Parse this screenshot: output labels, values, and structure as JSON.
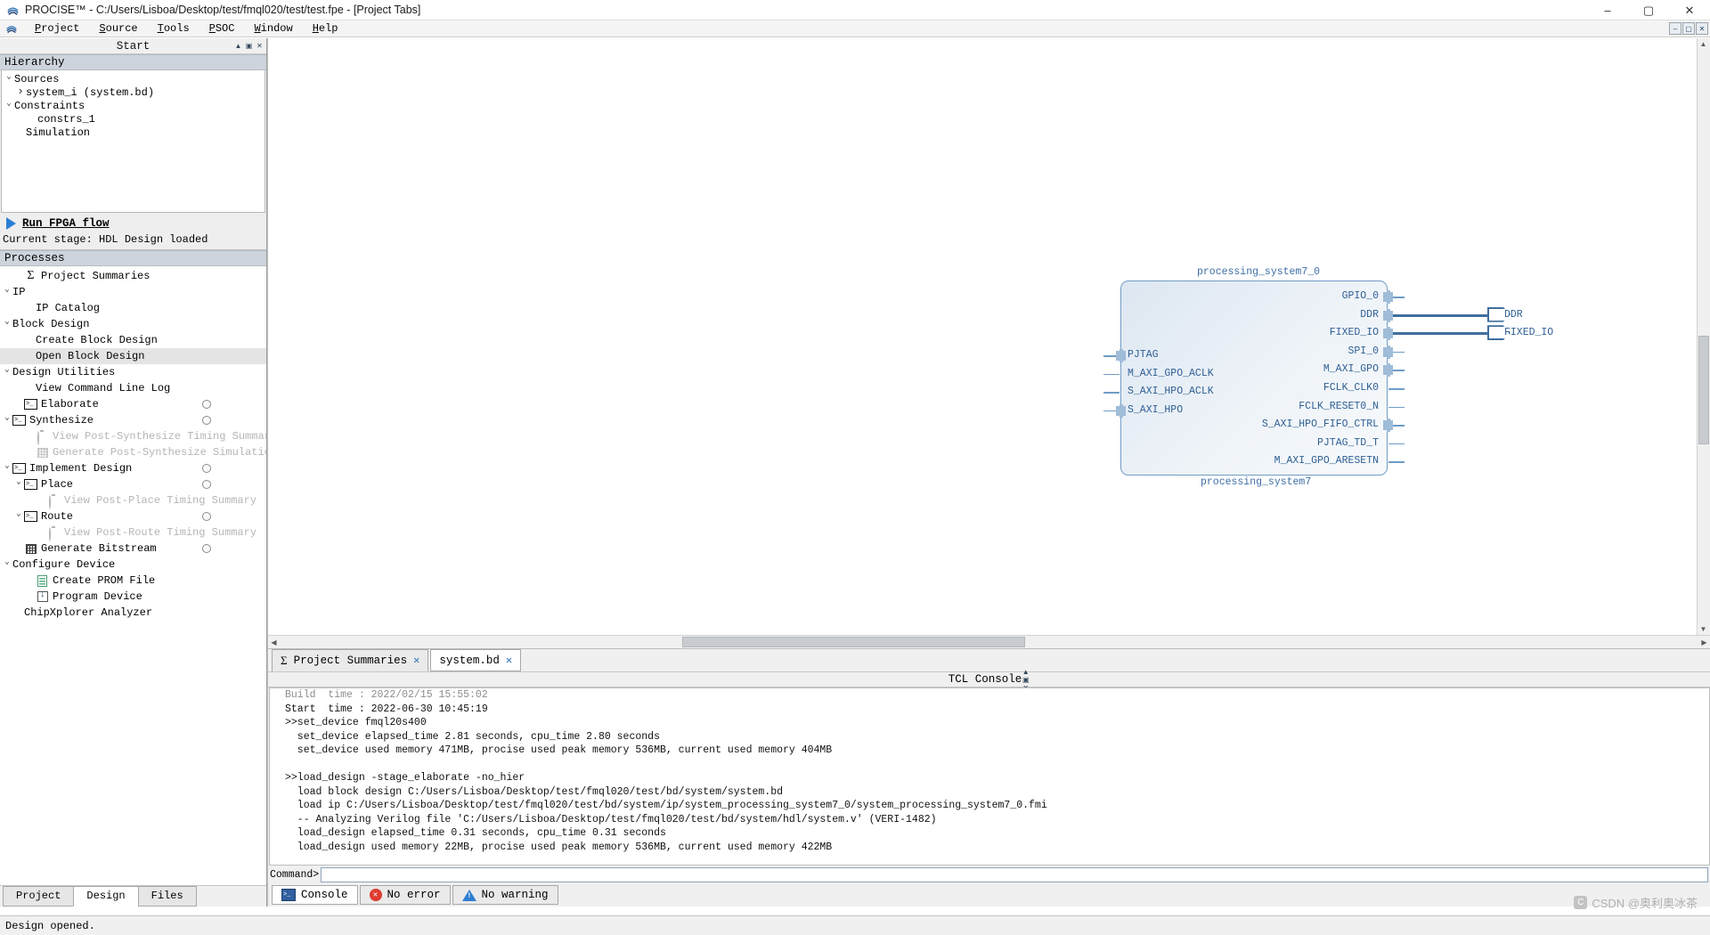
{
  "titlebar": {
    "title": "PROCISE™ - C:/Users/Lisboa/Desktop/test/fmql020/test/test.fpe - [Project Tabs]",
    "app_icon": "procise-logo-icon",
    "minimize": "–",
    "maximize": "▢",
    "close": "✕"
  },
  "menubar": {
    "items": [
      {
        "label": "Project",
        "accel": "P"
      },
      {
        "label": "Source",
        "accel": "S"
      },
      {
        "label": "Tools",
        "accel": "T"
      },
      {
        "label": "PSOC",
        "accel": "P"
      },
      {
        "label": "Window",
        "accel": "W"
      },
      {
        "label": "Help",
        "accel": "H"
      }
    ],
    "mdi_buttons": [
      "–",
      "▢",
      "✕"
    ]
  },
  "left_panel": {
    "panel_title": "Start",
    "panel_buttons": [
      "▲",
      "▣",
      "✕"
    ],
    "hierarchy": {
      "header": "Hierarchy",
      "rows": [
        {
          "label": "Sources",
          "indent": 0,
          "chev": "down",
          "selected": false
        },
        {
          "label": "system_i (system.bd)",
          "indent": 1,
          "chev": "right",
          "selected": false
        },
        {
          "label": "Constraints",
          "indent": 0,
          "chev": "down",
          "selected": false
        },
        {
          "label": "constrs_1",
          "indent": 2,
          "chev": "blank",
          "selected": false
        },
        {
          "label": "Simulation",
          "indent": 1,
          "chev": "blank",
          "selected": false
        }
      ]
    },
    "run_flow": {
      "label": "Run FPGA flow",
      "stage_text": "Current stage: HDL Design loaded"
    },
    "processes": {
      "header": "Processes",
      "rows": [
        {
          "label": "Project Summaries",
          "indent": 1,
          "chev": "blank",
          "icon": "sigma-icon",
          "dim": false,
          "selected": false,
          "circle": false
        },
        {
          "label": "IP",
          "indent": 0,
          "chev": "down",
          "icon": "none",
          "dim": false,
          "selected": false,
          "circle": false
        },
        {
          "label": "IP Catalog",
          "indent": 2,
          "chev": "blank",
          "icon": "none",
          "dim": false,
          "selected": false,
          "circle": false
        },
        {
          "label": "Block Design",
          "indent": 0,
          "chev": "down",
          "icon": "none",
          "dim": false,
          "selected": false,
          "circle": false
        },
        {
          "label": "Create Block Design",
          "indent": 2,
          "chev": "blank",
          "icon": "none",
          "dim": false,
          "selected": false,
          "circle": false
        },
        {
          "label": "Open Block Design",
          "indent": 2,
          "chev": "blank",
          "icon": "none",
          "dim": false,
          "selected": true,
          "circle": false
        },
        {
          "label": "Design Utilities",
          "indent": 0,
          "chev": "down",
          "icon": "none",
          "dim": false,
          "selected": false,
          "circle": false
        },
        {
          "label": "View Command Line Log",
          "indent": 2,
          "chev": "blank",
          "icon": "none",
          "dim": false,
          "selected": false,
          "circle": false
        },
        {
          "label": "Elaborate",
          "indent": 1,
          "chev": "blank",
          "icon": "terminal-icon",
          "dim": false,
          "selected": false,
          "circle": true
        },
        {
          "label": "Synthesize",
          "indent": 0,
          "chev": "down",
          "icon": "terminal-icon",
          "dim": false,
          "selected": false,
          "circle": true
        },
        {
          "label": "View Post-Synthesize Timing Summary",
          "indent": 2,
          "chev": "blank",
          "icon": "stopwatch-icon",
          "dim": true,
          "selected": false,
          "circle": false
        },
        {
          "label": "Generate Post-Synthesize Simulation File",
          "indent": 2,
          "chev": "blank",
          "icon": "grid-icon",
          "dim": true,
          "selected": false,
          "circle": false
        },
        {
          "label": "Implement Design",
          "indent": 0,
          "chev": "down",
          "icon": "terminal-icon",
          "dim": false,
          "selected": false,
          "circle": true
        },
        {
          "label": "Place",
          "indent": 1,
          "chev": "down",
          "icon": "terminal-icon",
          "dim": false,
          "selected": false,
          "circle": true
        },
        {
          "label": "View Post-Place Timing Summary",
          "indent": 3,
          "chev": "blank",
          "icon": "stopwatch-icon",
          "dim": true,
          "selected": false,
          "circle": false
        },
        {
          "label": "Route",
          "indent": 1,
          "chev": "down",
          "icon": "terminal-icon",
          "dim": false,
          "selected": false,
          "circle": true
        },
        {
          "label": "View Post-Route Timing Summary",
          "indent": 3,
          "chev": "blank",
          "icon": "stopwatch-icon",
          "dim": true,
          "selected": false,
          "circle": false
        },
        {
          "label": "Generate Bitstream",
          "indent": 1,
          "chev": "blank",
          "icon": "grid-icon",
          "dim": false,
          "selected": false,
          "circle": true
        },
        {
          "label": "Configure Device",
          "indent": 0,
          "chev": "down",
          "icon": "none",
          "dim": false,
          "selected": false,
          "circle": false
        },
        {
          "label": "Create PROM File",
          "indent": 2,
          "chev": "blank",
          "icon": "document-icon",
          "dim": false,
          "selected": false,
          "circle": false
        },
        {
          "label": "Program Device",
          "indent": 2,
          "chev": "blank",
          "icon": "download-icon",
          "dim": false,
          "selected": false,
          "circle": false
        },
        {
          "label": "ChipXplorer Analyzer",
          "indent": 1,
          "chev": "blank",
          "icon": "none",
          "dim": false,
          "selected": false,
          "circle": false
        }
      ]
    },
    "tabs": [
      {
        "label": "Project",
        "active": false
      },
      {
        "label": "Design",
        "active": true
      },
      {
        "label": "Files",
        "active": false
      }
    ]
  },
  "canvas": {
    "block": {
      "top_label": "processing_system7_0",
      "bottom_label": "processing_system7",
      "inputs": [
        {
          "name": "PJTAG",
          "bus": true
        },
        {
          "name": "M_AXI_GPO_ACLK",
          "bus": false
        },
        {
          "name": "S_AXI_HPO_ACLK",
          "bus": false
        },
        {
          "name": "S_AXI_HPO",
          "bus": true
        }
      ],
      "outputs": [
        {
          "name": "GPIO_0",
          "bus": true
        },
        {
          "name": "DDR",
          "bus": true
        },
        {
          "name": "FIXED_IO",
          "bus": true
        },
        {
          "name": "SPI_0",
          "bus": true
        },
        {
          "name": "M_AXI_GPO",
          "bus": true
        },
        {
          "name": "FCLK_CLK0",
          "bus": false
        },
        {
          "name": "FCLK_RESET0_N",
          "bus": false
        },
        {
          "name": "S_AXI_HPO_FIFO_CTRL",
          "bus": true
        },
        {
          "name": "PJTAG_TD_T",
          "bus": false
        },
        {
          "name": "M_AXI_GPO_ARESETN",
          "bus": false
        }
      ]
    },
    "external_ports": [
      {
        "label": "DDR"
      },
      {
        "label": "FIXED_IO"
      }
    ]
  },
  "editor_tabs": [
    {
      "label": "Project Summaries",
      "icon": "sigma-icon",
      "close": "✕",
      "active": false
    },
    {
      "label": "system.bd",
      "icon": "none",
      "close": "✕",
      "active": true
    }
  ],
  "console": {
    "title": "TCL Console",
    "panel_buttons": [
      "▲",
      "▣",
      "✕"
    ],
    "lines": [
      {
        "text": "Build  time : 2022/02/15 15:55:02",
        "clipped": true
      },
      {
        "text": "Start  time : 2022-06-30 10:45:19",
        "clipped": false
      },
      {
        "text": ">>set_device fmql20s400",
        "clipped": false
      },
      {
        "text": "  set_device elapsed_time 2.81 seconds, cpu_time 2.80 seconds",
        "clipped": false
      },
      {
        "text": "  set_device used memory 471MB, procise used peak memory 536MB, current used memory 404MB",
        "clipped": false
      },
      {
        "text": "",
        "clipped": false
      },
      {
        "text": ">>load_design -stage_elaborate -no_hier",
        "clipped": false
      },
      {
        "text": "  load block design C:/Users/Lisboa/Desktop/test/fmql020/test/bd/system/system.bd",
        "clipped": false
      },
      {
        "text": "  load ip C:/Users/Lisboa/Desktop/test/fmql020/test/bd/system/ip/system_processing_system7_0/system_processing_system7_0.fmi",
        "clipped": false
      },
      {
        "text": "  -- Analyzing Verilog file 'C:/Users/Lisboa/Desktop/test/fmql020/test/bd/system/hdl/system.v' (VERI-1482)",
        "clipped": false
      },
      {
        "text": "  load_design elapsed_time 0.31 seconds, cpu_time 0.31 seconds",
        "clipped": false
      },
      {
        "text": "  load_design used memory 22MB, procise used peak memory 536MB, current used memory 422MB",
        "clipped": false
      }
    ],
    "command_label": "Command>",
    "command_value": "",
    "tabs": [
      {
        "label": "Console",
        "icon": "console-icon",
        "active": true
      },
      {
        "label": "No error",
        "icon": "error-icon",
        "active": false
      },
      {
        "label": "No warning",
        "icon": "warning-icon",
        "active": false
      }
    ]
  },
  "statusbar": {
    "text": "Design opened."
  },
  "watermark": {
    "text": "CSDN @奥利奥冰茶"
  }
}
